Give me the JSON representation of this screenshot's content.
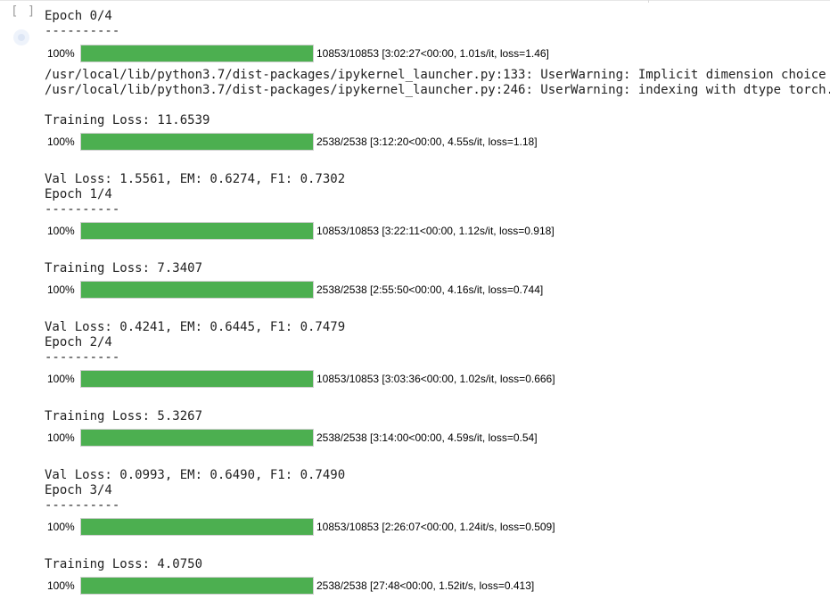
{
  "cell": {
    "run_indicator": "[ ]"
  },
  "output": {
    "lines": [
      "Epoch 0/4",
      "----------",
      "/usr/local/lib/python3.7/dist-packages/ipykernel_launcher.py:133: UserWarning: Implicit dimension choice",
      "/usr/local/lib/python3.7/dist-packages/ipykernel_launcher.py:246: UserWarning: indexing with dtype torch.",
      "Training Loss: 11.6539",
      "Val Loss: 1.5561, EM: 0.6274, F1: 0.7302",
      "Epoch 1/4",
      "----------",
      "Training Loss: 7.3407",
      "Val Loss: 0.4241, EM: 0.6445, F1: 0.7479",
      "Epoch 2/4",
      "----------",
      "Training Loss: 5.3267",
      "Val Loss: 0.0993, EM: 0.6490, F1: 0.7490",
      "Epoch 3/4",
      "----------",
      "Training Loss: 4.0750"
    ],
    "progress_bars": [
      {
        "percent": "100%",
        "fraction": 1.0,
        "stats": "10853/10853 [3:02:27<00:00, 1.01s/it, loss=1.46]"
      },
      {
        "percent": "100%",
        "fraction": 1.0,
        "stats": "2538/2538 [3:12:20<00:00, 4.55s/it, loss=1.18]"
      },
      {
        "percent": "100%",
        "fraction": 1.0,
        "stats": "10853/10853 [3:22:11<00:00, 1.12s/it, loss=0.918]"
      },
      {
        "percent": "100%",
        "fraction": 1.0,
        "stats": "2538/2538 [2:55:50<00:00, 4.16s/it, loss=0.744]"
      },
      {
        "percent": "100%",
        "fraction": 1.0,
        "stats": "10853/10853 [3:03:36<00:00, 1.02s/it, loss=0.666]"
      },
      {
        "percent": "100%",
        "fraction": 1.0,
        "stats": "2538/2538 [3:14:00<00:00, 4.59s/it, loss=0.54]"
      },
      {
        "percent": "100%",
        "fraction": 1.0,
        "stats": "10853/10853 [2:26:07<00:00, 1.24it/s, loss=0.509]"
      },
      {
        "percent": "100%",
        "fraction": 1.0,
        "stats": "2538/2538 [27:48<00:00, 1.52it/s, loss=0.413]"
      }
    ]
  },
  "colors": {
    "progress_fill": "#4caf50",
    "progress_track": "#eeeeee",
    "text": "#212121"
  }
}
